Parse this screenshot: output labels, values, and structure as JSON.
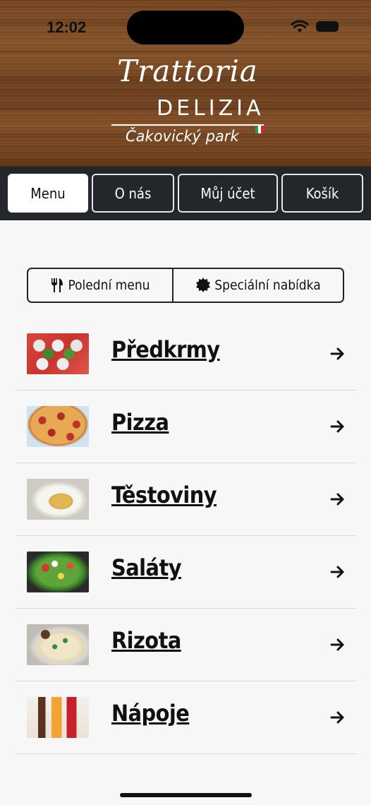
{
  "status_bar": {
    "time": "12:02"
  },
  "header": {
    "logo_script": "Trattoria",
    "logo_name": "DELIZIA",
    "logo_location": "Čakovický park"
  },
  "nav": {
    "items": [
      {
        "label": "Menu",
        "active": true
      },
      {
        "label": "O nás",
        "active": false
      },
      {
        "label": "Můj účet",
        "active": false
      },
      {
        "label": "Košík",
        "active": false
      }
    ]
  },
  "subtabs": {
    "lunch": {
      "label": "Polední menu",
      "icon": "utensils-icon"
    },
    "special": {
      "label": "Speciální nabídka",
      "icon": "badge-icon"
    }
  },
  "categories": [
    {
      "label": "Předkrmy",
      "icon": "arrow-right-icon"
    },
    {
      "label": "Pizza",
      "icon": "arrow-right-icon"
    },
    {
      "label": "Těstoviny",
      "icon": "arrow-right-icon"
    },
    {
      "label": "Saláty",
      "icon": "arrow-right-icon"
    },
    {
      "label": "Rizota",
      "icon": "arrow-right-icon"
    },
    {
      "label": "Nápoje",
      "icon": "arrow-right-icon"
    }
  ],
  "colors": {
    "nav_bg": "#23272b",
    "accent_white": "#ffffff",
    "text": "#111111",
    "flag_green": "#2e9b3e",
    "flag_red": "#d9262c"
  }
}
